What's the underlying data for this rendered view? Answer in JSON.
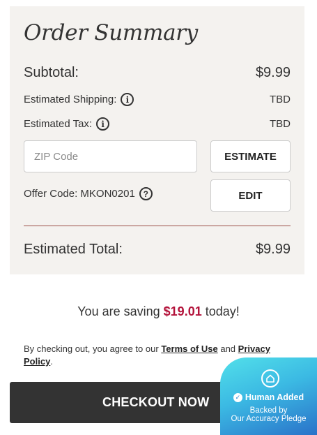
{
  "summary": {
    "title": "Order Summary",
    "subtotal_label": "Subtotal:",
    "subtotal_value": "$9.99",
    "shipping_label": "Estimated Shipping:",
    "shipping_value": "TBD",
    "tax_label": "Estimated Tax:",
    "tax_value": "TBD",
    "zip_placeholder": "ZIP Code",
    "zip_value": "",
    "estimate_button": "ESTIMATE",
    "offer_label": "Offer Code: MKON0201",
    "edit_button": "EDIT",
    "total_label": "Estimated Total:",
    "total_value": "$9.99"
  },
  "saving": {
    "prefix": "You are saving",
    "amount": "$19.01",
    "suffix": "today!"
  },
  "terms": {
    "prefix": "By checking out, you agree to our",
    "terms_link": "Terms of Use",
    "conjunction": "and",
    "privacy_link": "Privacy Policy",
    "suffix": "."
  },
  "checkout": {
    "label": "CHECKOUT NOW"
  },
  "badge": {
    "headline": "Human Added",
    "line2": "Backed by",
    "line3": "Our Accuracy Pledge",
    "icon": "house-icon"
  },
  "colors": {
    "panel_bg": "#f4f2ef",
    "accent_red": "#b3123a",
    "divider": "#9a4d47",
    "checkout_bg": "#333333",
    "badge_gradient_start": "#52e0ea",
    "badge_gradient_end": "#2a72c9"
  }
}
